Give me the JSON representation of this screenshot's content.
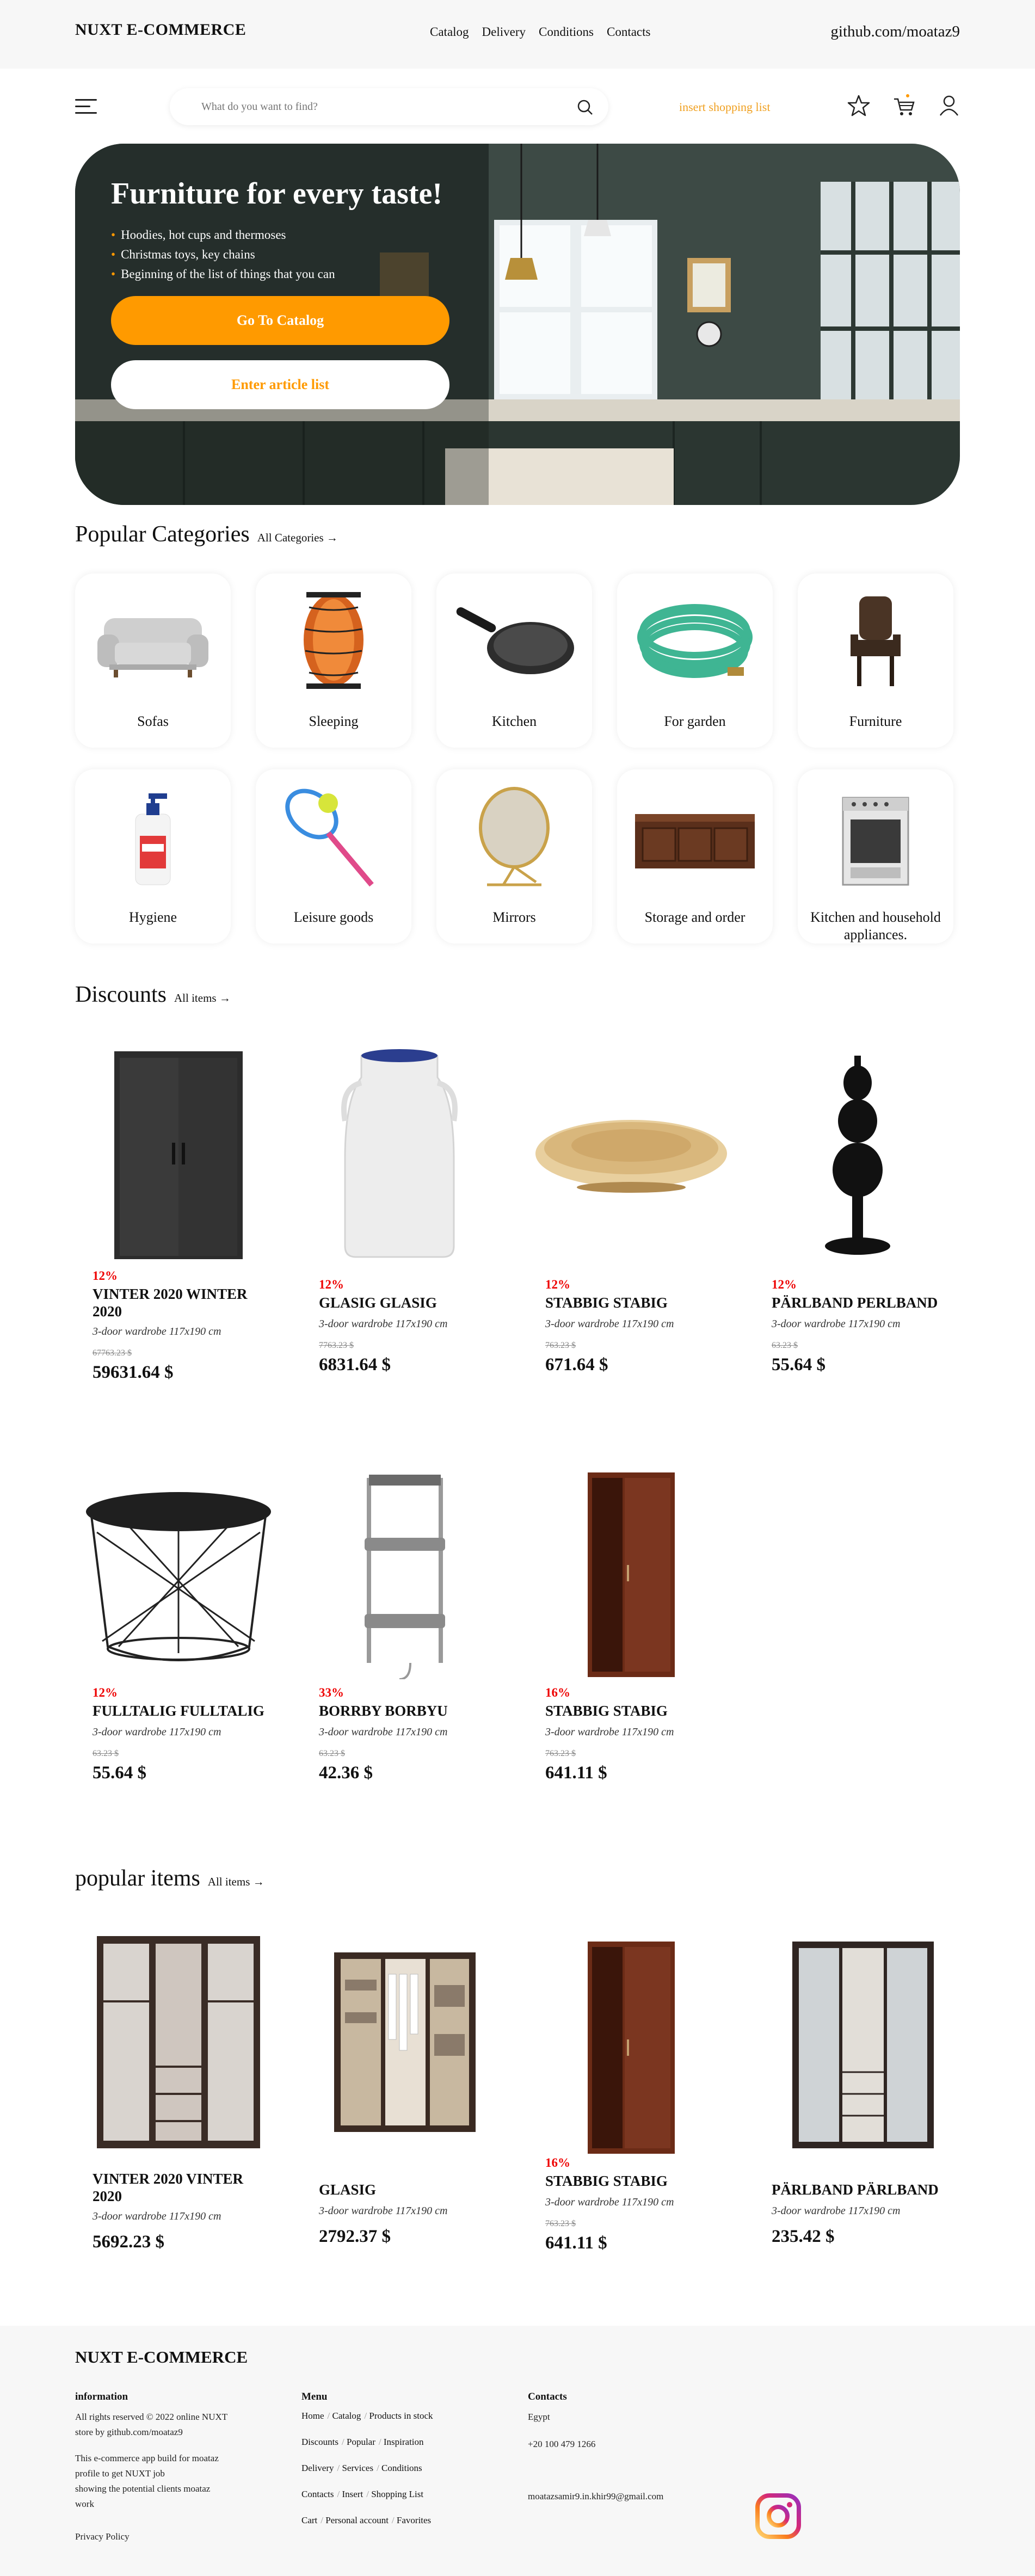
{
  "topbar": {
    "brand": "NUXT E-COMMERCE",
    "nav": [
      "Catalog",
      "Delivery",
      "Conditions",
      "Contacts"
    ],
    "github": "github.com/moataz9"
  },
  "header": {
    "search_placeholder": "What do you want to find?",
    "insert_label": "insert shopping list",
    "icons": [
      "menu-icon",
      "search-icon",
      "star-icon",
      "cart-icon",
      "user-icon"
    ]
  },
  "hero": {
    "title": "Furniture for every taste!",
    "bullets": [
      "Hoodies, hot cups and thermoses",
      "Christmas toys, key chains",
      "Beginning of the list of things that you can"
    ],
    "catalog_button": "Go To Catalog",
    "article_button": "Enter article list"
  },
  "categories": {
    "title": "Popular Categories",
    "more": "All Categories →",
    "items": [
      {
        "label": "Sofas",
        "icon": "sofa-icon"
      },
      {
        "label": "Sleeping",
        "icon": "lamp-icon"
      },
      {
        "label": "Kitchen",
        "icon": "pan-icon"
      },
      {
        "label": "For garden",
        "icon": "hose-icon"
      },
      {
        "label": "Furniture",
        "icon": "chair-icon"
      },
      {
        "label": "Hygiene",
        "icon": "soap-icon"
      },
      {
        "label": "Leisure goods",
        "icon": "racket-icon"
      },
      {
        "label": "Mirrors",
        "icon": "mirror-icon"
      },
      {
        "label": "Storage and order",
        "icon": "chest-icon"
      },
      {
        "label": "Kitchen and household appliances.",
        "icon": "stove-icon"
      }
    ]
  },
  "discounts": {
    "title": "Discounts",
    "more": "All items →",
    "items": [
      {
        "discount": "12%",
        "name": "VINTER 2020 WINTER 2020",
        "desc": "3-door wardrobe 117x190 cm",
        "old": "67763.23 $",
        "price": "59631.64 $"
      },
      {
        "discount": "12%",
        "name": "GLASIG GLASIG",
        "desc": "3-door wardrobe 117x190 cm",
        "old": "7763.23 $",
        "price": "6831.64 $"
      },
      {
        "discount": "12%",
        "name": "STABBIG STABIG",
        "desc": "3-door wardrobe 117x190 cm",
        "old": "763.23 $",
        "price": "671.64 $"
      },
      {
        "discount": "12%",
        "name": "PÄRLBAND PERLBAND",
        "desc": "3-door wardrobe 117x190 cm",
        "old": "63.23 $",
        "price": "55.64 $"
      },
      {
        "discount": "12%",
        "name": "FULLTALIG FULLTALIG",
        "desc": "3-door wardrobe 117x190 cm",
        "old": "63.23 $",
        "price": "55.64 $"
      },
      {
        "discount": "33%",
        "name": "BORRBY BORBYU",
        "desc": "3-door wardrobe 117x190 cm",
        "old": "63.23 $",
        "price": "42.36 $"
      },
      {
        "discount": "16%",
        "name": "STABBIG STABIG",
        "desc": "3-door wardrobe 117x190 cm",
        "old": "763.23 $",
        "price": "641.11 $"
      }
    ]
  },
  "popular": {
    "title": "popular items",
    "more": "All items →",
    "items": [
      {
        "discount": "",
        "name": "VINTER 2020 VINTER 2020",
        "desc": "3-door wardrobe 117x190 cm",
        "old": "",
        "price": "5692.23 $"
      },
      {
        "discount": "",
        "name": "GLASIG",
        "desc": "3-door wardrobe 117x190 cm",
        "old": "",
        "price": "2792.37 $"
      },
      {
        "discount": "16%",
        "name": "STABBIG STABIG",
        "desc": "3-door wardrobe 117x190 cm",
        "old": "763.23 $",
        "price": "641.11 $"
      },
      {
        "discount": "",
        "name": "PÄRLBAND PÄRLBAND",
        "desc": "3-door wardrobe 117x190 cm",
        "old": "",
        "price": "235.42 $"
      }
    ]
  },
  "footer": {
    "brand": "NUXT E-COMMERCE",
    "info_title": "information",
    "info_lines": [
      "All rights reserved © 2022 online NUXT",
      "store by github.com/moataz9"
    ],
    "info_about": [
      "This e-commerce app build for moataz",
      "profile to get NUXT job",
      "showing the potential clients moataz",
      "work"
    ],
    "privacy": "Privacy Policy",
    "menu_title": "Menu",
    "menu_rows": [
      [
        "Home",
        "Catalog",
        "Products in stock"
      ],
      [
        "Discounts",
        "Popular",
        "Inspiration"
      ],
      [
        "Delivery",
        "Services",
        "Conditions"
      ],
      [
        "Contacts",
        "Insert",
        "Shopping List"
      ],
      [
        "Cart",
        "Personal account",
        "Favorites"
      ]
    ],
    "contacts_title": "Contacts",
    "country": "Egypt",
    "phone": "+20 100 479 1266",
    "email": "moatazsamir9.in.khir99@gmail.com"
  },
  "colors": {
    "accent": "#ff9a00",
    "discount": "#e00000",
    "footer_bg": "#f7f7f7"
  }
}
